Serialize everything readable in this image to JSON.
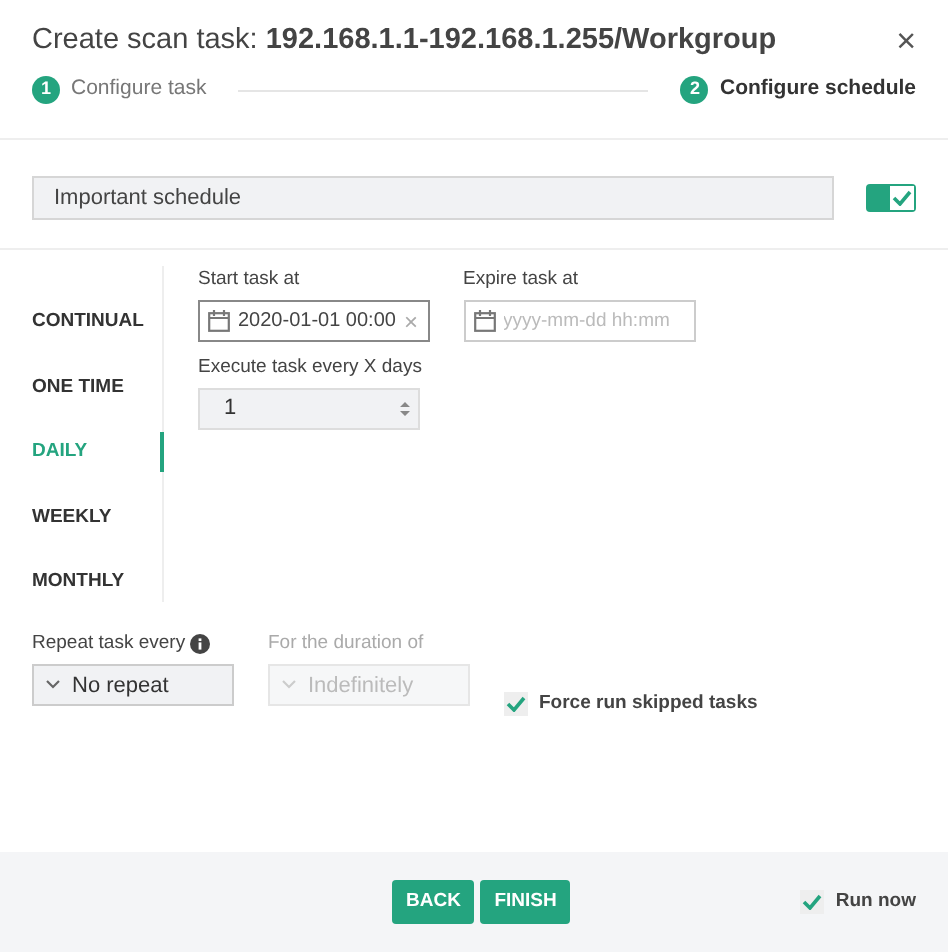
{
  "dialog": {
    "title": "Create scan task: **192.168.1.1-192.168.1.255/Workgroup**",
    "close": "×"
  },
  "steps": [
    {
      "number": "1",
      "label": "Configure task",
      "selected": false
    },
    {
      "number": "2",
      "label": "Configure schedule",
      "selected": true
    }
  ],
  "schedule_name": {
    "value": "Important schedule"
  },
  "enabled_toggle": {
    "on": true
  },
  "schedule_types": [
    {
      "label": "CONTINUAL",
      "selected": false
    },
    {
      "label": "ONE TIME",
      "selected": false
    },
    {
      "label": "DAILY",
      "selected": true
    },
    {
      "label": "WEEKLY",
      "selected": false
    },
    {
      "label": "MONTHLY",
      "selected": false
    }
  ],
  "start_task": {
    "label": "Start task at",
    "value": "2020-01-01 00:00",
    "clear": "×"
  },
  "expire_task": {
    "label": "Expire task at",
    "placeholder": "yyyy-mm-dd hh:mm"
  },
  "execute_every": {
    "label": "Execute task every X days",
    "value": "1"
  },
  "repeat": {
    "label": "Repeat task every",
    "value": "No repeat",
    "disabled": false
  },
  "duration": {
    "label": "For the duration of",
    "value": "Indefinitely",
    "disabled": true
  },
  "force_run": {
    "label": "Force run skipped tasks",
    "checked": true
  },
  "buttons": [
    {
      "label": "BACK"
    },
    {
      "label": "FINISH"
    }
  ],
  "run_now": {
    "label": "Run now",
    "checked": true
  }
}
